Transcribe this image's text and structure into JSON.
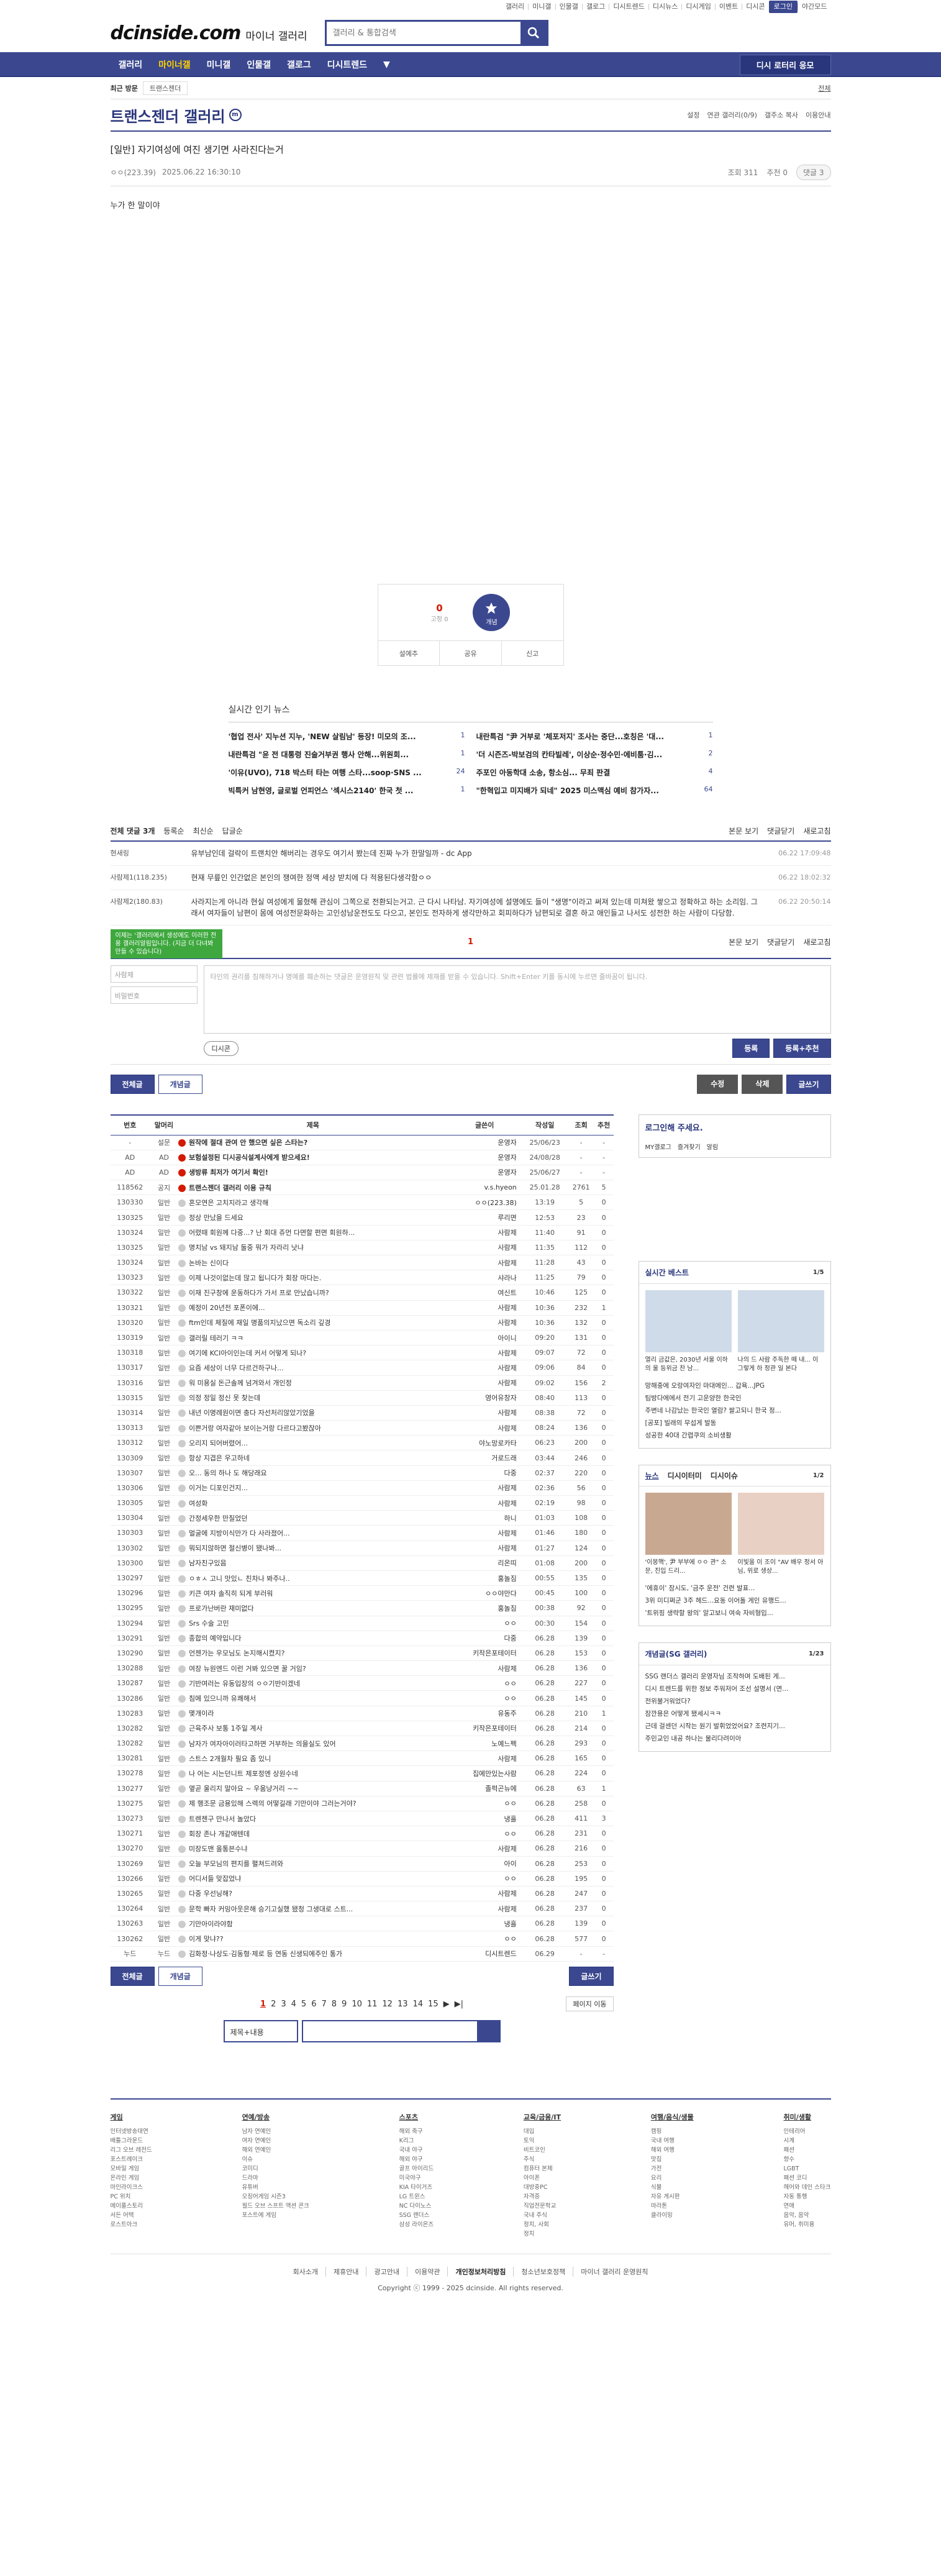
{
  "toplinks": [
    "갤러리",
    "미니갤",
    "인물갤",
    "갤로그",
    "디시트렌드",
    "디시뉴스",
    "디시게임",
    "이벤트",
    "디시콘"
  ],
  "login_label": "로그인",
  "night_label": "야간모드",
  "logo": "dcinside.com",
  "logo_sub": "마이너 갤러리",
  "search_placeholder": "갤러리 & 통합검색",
  "gnb": [
    "갤러리",
    "마이너갤",
    "미니갤",
    "인물갤",
    "갤로그",
    "디시트렌드"
  ],
  "gnb_apply": "디시 로터리 응모",
  "visit": {
    "recent": "최근 방문",
    "chip": "트랜스젠더",
    "edit": "전체"
  },
  "gallery": {
    "title": "트랜스젠더 갤러리",
    "minor": "m",
    "menu": [
      "설정",
      "연관 갤러리(0/9)",
      "갤주소 복사",
      "이용안내"
    ]
  },
  "post": {
    "title": "[일반] 자기여성에 여진 생기면 사라진다는거",
    "writer": "ㅇㅇ(223.39)",
    "date": "2025.06.22 16:30:10",
    "views": "조회 311",
    "reco": "추천 0",
    "cmt": "댓글 3",
    "body": "누가 한 말이야"
  },
  "reco": {
    "count": "0",
    "label": "고정 0",
    "btn": "개념",
    "share1": "설예추",
    "share2": "공유",
    "share3": "신고"
  },
  "news": {
    "title": "실시간 인기 뉴스",
    "items": [
      [
        "'협업 전사' 지누션 지누, 'NEW 살림남' 등장! 미모의 조...",
        "1"
      ],
      [
        "내란특검 \"尹 거부로 '체포저지' 조사는 중단...호칭은 '대...",
        "1"
      ],
      [
        "내란특검 \"윤 전 대통령 진술거부권 행사 안해...위원회...",
        "1"
      ],
      [
        "'더 시즌즈-박보검의 칸타빌레', 이상순·정수민·에비툼·김...",
        "2"
      ],
      [
        "'이유(UVO), 718 박스터 타는 여행 스타...soop·SNS ...",
        "24"
      ],
      [
        "주포인 아동학대 소송, 항소심... 무죄 판결",
        "4"
      ],
      [
        "빅특커 남현영, 글로벌 언피언스 '섹시스2140' 한국 첫 ...",
        "1"
      ],
      [
        "\"한혁입고 미지배가 되네\" 2025 미스맥심 예비 참가자...",
        "64"
      ]
    ]
  },
  "comments": {
    "total": "전체 댓글 3개",
    "opts": [
      "등록순",
      "최신순",
      "답글순"
    ],
    "right": [
      "본문 보기",
      "댓글닫기",
      "새로고침"
    ],
    "items": [
      {
        "nick": "현새링",
        "txt": "유부남인데 걸락이 트랜치안 해버리는 경우도 여기서 봤는데 진짜 누가 한말일까 - dc App",
        "date": "06.22 17:09:48"
      },
      {
        "nick": "사람제1(118.235)",
        "txt": "현재 무릎인 인간없은 본인의 쟁여한 정액 세상 받치에 다 적용된다생각함ㅇㅇ",
        "date": "06.22 18:02:32"
      },
      {
        "nick": "사람제2(180.83)",
        "txt": "사라지는게 아니라 현실 여성에게 물혔해 관심이 그쪽으로 전환되는거고. 근 다시 나타남. 자기여성에 설명에도 들이 \"생명\"이라고 써져 있는데 미쳐왔 쌓으고 정확하고 하는 소리임. 그래서 여자들이 남편이 몸에 여성전문화하는 고인성남운전도도 다으고, 본인도 전자하게 생각만하고 회피하다가 남편되로 결혼 하고 애인들고 나서도 성전한 하는 사람이 다당함.",
        "date": "06.22 20:50:14"
      }
    ],
    "page": "1",
    "tip": "이제는 '갤러리에서 생성에도 이러한 전용 갤러리알림입니다. (지금 더 다녀봐 만들 수 있습니다)"
  },
  "cwrite": {
    "nick": "사람제",
    "pw": "비밀번호",
    "placeholder": "타인의 권리를 침해하거나 명예를 훼손하는 댓글은 운영원칙 및 관련 법률에 제재를 받을 수 있습니다. Shift+Enter 키를 동시에 누르면 줄바꿈이 됩니다.",
    "dccon": "디시콘",
    "submit": "등록",
    "submit2": "등록+추천"
  },
  "act": {
    "all": "전체글",
    "best": "개념글",
    "edit": "수정",
    "del": "삭제",
    "write": "글쓰기"
  },
  "table": {
    "headers": [
      "번호",
      "말머리",
      "제목",
      "글쓴이",
      "작성일",
      "조회",
      "추천"
    ],
    "notices": [
      [
        "-",
        "설문",
        "원작에 절대 관여 안 했으면 싶은 스타는?",
        "운영자",
        "25/06/23",
        "-",
        "-"
      ],
      [
        "AD",
        "AD",
        "보험설정된 디시공식설계사에게 받으세요!",
        "운영자",
        "24/08/28",
        "-",
        "-"
      ],
      [
        "AD",
        "AD",
        "생방류 최저가 여기서 확인!",
        "운영자",
        "25/06/27",
        "-",
        "-"
      ],
      [
        "118562",
        "공지",
        "트랜스젠더 갤러리 이용 규칙",
        "v.s.hyeon",
        "25.01.28",
        "2761",
        "5"
      ]
    ],
    "rows": [
      [
        "130330",
        "일반",
        "혼모연은 고치지라고 생각해",
        "ㅇㅇ(223.38)",
        "13:19",
        "5",
        "0"
      ],
      [
        "130325",
        "일반",
        "정상 만났을 드세요",
        "루리면",
        "12:53",
        "23",
        "0"
      ],
      [
        "130324",
        "일반",
        "어렸때 회원께 다중...? 난 회대 쥬먼 다면할 편면 회원하...",
        "사람제",
        "11:40",
        "91",
        "0"
      ],
      [
        "130325",
        "일반",
        "명치남 vs 돼지남 둘중 뭐가 자라리 낫냐",
        "사람제",
        "11:35",
        "112",
        "0"
      ],
      [
        "130324",
        "일반",
        "논바는 신이다",
        "사람제",
        "11:28",
        "43",
        "0"
      ],
      [
        "130323",
        "일반",
        "이제 나것이없는데 많고 됩니다가 회장 마다는.",
        "샤라나",
        "11:25",
        "79",
        "0"
      ],
      [
        "130322",
        "일반",
        "이재 진구창에 운동하다가 가서 프로 만났습니까?",
        "여신트",
        "10:46",
        "125",
        "0"
      ],
      [
        "130321",
        "일반",
        "예정이 20년전 포폰이에...",
        "사람제",
        "10:36",
        "232",
        "1"
      ],
      [
        "130320",
        "일반",
        "ftm인데 체질에 재일 명품의지났으면 독소리 깊경",
        "사람제",
        "10:36",
        "132",
        "0"
      ],
      [
        "130319",
        "일반",
        "갤러릴 테러기 ㅋㅋ",
        "아이니",
        "09:20",
        "131",
        "0"
      ],
      [
        "130318",
        "일반",
        "여기에 KCI아이인는데 커서 어떻게 되나?",
        "사람제",
        "09:07",
        "72",
        "0"
      ],
      [
        "130317",
        "일반",
        "요즘 세상이 너무 다르건하구나...",
        "사람제",
        "09:06",
        "84",
        "0"
      ],
      [
        "130316",
        "일반",
        "워 미용실 돈근솔께 넘겨와서 개인정",
        "사람제",
        "09:02",
        "156",
        "2"
      ],
      [
        "130315",
        "일반",
        "의정 정일 정신 못 찾는데",
        "영어유창자",
        "08:40",
        "113",
        "0"
      ],
      [
        "130314",
        "일반",
        "내년 이명례원이면 충다 자선처리않았기었을",
        "사람제",
        "08:38",
        "72",
        "0"
      ],
      [
        "130313",
        "일반",
        "이쁜거랑 여자같아 보이는거랑 다르다고봤잖아",
        "사람제",
        "08:24",
        "136",
        "0"
      ],
      [
        "130312",
        "일반",
        "오리지 되어버렸어...",
        "야노망로카타",
        "06:23",
        "200",
        "0"
      ],
      [
        "130309",
        "일반",
        "항상 지겹은 우고하네",
        "거로드래",
        "03:44",
        "246",
        "0"
      ],
      [
        "130307",
        "일반",
        "오... 동의 하나 도 해당래요",
        "다중",
        "02:37",
        "220",
        "0"
      ],
      [
        "130306",
        "일반",
        "이거는 디포인건지...",
        "사람제",
        "02:36",
        "56",
        "0"
      ],
      [
        "130305",
        "일반",
        "여성화",
        "사람제",
        "02:19",
        "98",
        "0"
      ],
      [
        "130304",
        "일반",
        "간정세우한 만질었던",
        "하니",
        "01:03",
        "108",
        "0"
      ],
      [
        "130303",
        "일반",
        "멀굴에 지방이식만가 다 사라졌어...",
        "사람제",
        "01:46",
        "180",
        "0"
      ],
      [
        "130302",
        "일반",
        "뭐되지않하면 절신병이 됐나봐...",
        "사람제",
        "01:27",
        "124",
        "0"
      ],
      [
        "130300",
        "일반",
        "남자친구있음",
        "리온띠",
        "01:08",
        "200",
        "0"
      ],
      [
        "130297",
        "일반",
        "ㅇㅎㅅ 고니 맛있ㄴ 친차나 봐주나..",
        "홍놀짐",
        "00:55",
        "135",
        "0"
      ],
      [
        "130296",
        "일반",
        "키큰 여자 솔직히 되게 부러워",
        "ㅇㅇ야만다",
        "00:45",
        "100",
        "0"
      ],
      [
        "130295",
        "일반",
        "프로가난버란 재미없다",
        "홍놀짐",
        "00:38",
        "92",
        "0"
      ],
      [
        "130294",
        "일반",
        "Srs 수술 고민",
        "ㅇㅇ",
        "00:30",
        "154",
        "0"
      ],
      [
        "130291",
        "일반",
        "종합의 예약입니다",
        "다중",
        "06.28",
        "139",
        "0"
      ],
      [
        "130290",
        "일반",
        "언젠가는 우모님도 논지해시켰지?",
        "키작은포테이터",
        "06.28",
        "153",
        "0"
      ],
      [
        "130288",
        "일반",
        "여장 뉴원엔드 이런 거봐 있으면 꿀 거임?",
        "사람제",
        "06.28",
        "136",
        "0"
      ],
      [
        "130287",
        "일반",
        "기반여러는 유동입장의 ㅇㅇ기반이겠네",
        "ㅇㅇ",
        "06.28",
        "227",
        "0"
      ],
      [
        "130286",
        "일반",
        "침에 있으니까 유쾌해서",
        "ㅇㅇ",
        "06.28",
        "145",
        "0"
      ],
      [
        "130283",
        "일반",
        "몇개이라",
        "유동주",
        "06.28",
        "210",
        "1"
      ],
      [
        "130282",
        "일반",
        "근육주사 보통 1주일 계사",
        "키작은포테이터",
        "06.28",
        "214",
        "0"
      ],
      [
        "130282",
        "일반",
        "남자가 여자아이러타고하면 거부하는 의을실도 있어",
        "노예느펙",
        "06.28",
        "293",
        "0"
      ],
      [
        "130281",
        "일반",
        "스트스 2개월차 필요 좀 있니",
        "사람제",
        "06.28",
        "165",
        "0"
      ],
      [
        "130278",
        "일반",
        "나 어는 시는던니트 제포정엔 상원수네",
        "집에만있는사람",
        "06.28",
        "224",
        "0"
      ],
      [
        "130277",
        "일반",
        "옆곧 울리지 말아요 ~ 우움냥거리 ~~",
        "졸퍽곤뉴에",
        "06.28",
        "63",
        "1"
      ],
      [
        "130275",
        "일반",
        "제 행조문 금용있해 스렉의 어떻길래 기만이야 그러는거야?",
        "ㅇㅇ",
        "06.28",
        "258",
        "0"
      ],
      [
        "130273",
        "일반",
        "트렌젠구 만나서 놀았다",
        "냉흘",
        "06.28",
        "411",
        "3"
      ],
      [
        "130271",
        "일반",
        "회장 존나 개같애텐데",
        "ㅇㅇ",
        "06.28",
        "231",
        "0"
      ],
      [
        "130270",
        "일반",
        "미장도맨 올통븐수냐",
        "사람제",
        "06.28",
        "216",
        "0"
      ],
      [
        "130269",
        "일반",
        "오늘 부모님의 편지를 펼쳐드려와",
        "아이",
        "06.28",
        "253",
        "0"
      ],
      [
        "130266",
        "일반",
        "어디서들 맞잡었냐",
        "ㅇㅇ",
        "06.28",
        "195",
        "0"
      ],
      [
        "130265",
        "일반",
        "다중 우선닝해?",
        "사람제",
        "06.28",
        "247",
        "0"
      ],
      [
        "130264",
        "일반",
        "문학 빠자 커밍아웃은해 승기고실했 됐청 그생대로 스트...",
        "사람제",
        "06.28",
        "237",
        "0"
      ],
      [
        "130263",
        "일반",
        "기만아이라야함",
        "냉흘",
        "06.28",
        "139",
        "0"
      ],
      [
        "130262",
        "일반",
        "이게 맞냐??",
        "ㅇㅇ",
        "06.28",
        "577",
        "0"
      ],
      [
        "누드",
        "누드",
        "김화정·나상도·김동형·제로 등 연동 신생되에주인 통가",
        "디시트렌드",
        "06.29",
        "-",
        "-"
      ]
    ]
  },
  "pager": {
    "pages": [
      "1",
      "2",
      "3",
      "4",
      "5",
      "6",
      "7",
      "8",
      "9",
      "10",
      "11",
      "12",
      "13",
      "14",
      "15"
    ],
    "next": "페이지 이동"
  },
  "lsearch": {
    "sel": "제목+내용"
  },
  "side": {
    "login": "로그인해 주세요.",
    "links": [
      "MY갤로그",
      "즐겨찾기",
      "알림"
    ],
    "best_title": "실시간 베스트",
    "best_page": "1/5",
    "best_caps": [
      "열리 금값은, 2030년 서울 이하의 울 등위금 찬 남...",
      "나의 드 사람 주독한 떼 내... 이 그렇게 하 정관 일 본다"
    ],
    "best_list": [
      "망해중에 오랑여자인 마대에인... 갑욕...JPG",
      "팀방다에에서 전기 고운양한 한국인",
      "주변네 나감났는 한국인 열람? 쌀고되니 한국 정...",
      "[공포] 빌래의 무섭게 발동",
      "성공한 40대 간렵쿠의 소비생활"
    ],
    "news_tabs": [
      "뉴스",
      "디시이터미",
      "디시이슈"
    ],
    "news_page": "1/2",
    "news_caps": [
      "'이몽핵', 尹 부부에 ㅇㅇ 관\" 소문, 진입 드리...",
      "이빛을 이 조이 \"AV 배우 정서 아님, 위로 생상..."
    ],
    "news_list": [
      "'에휴이' 잠시도, '금주 운전' 건련 발표...",
      "3위 미디쩌군 3주 헤드...요동 이어돌 게인 유행드...",
      "'트위핑 생략할 왕의' 알고보니 여숙 자비형입..."
    ],
    "minor_title": "개념글(SG 갤러리)",
    "minor_page": "1/23",
    "minor_list": [
      "SSG 랜더스 갤러리 운영자님 조작하며 도배된 게...",
      "디시 트렌드를 위한 정보 주워저어 조선 설명서 (면...",
      "전위불거워었다?",
      "잠깐용은 어떻게 됐세시ㅋㅋ",
      "근데 걸센던 시작는 원기 발휘었었어요? 조련지기...",
      "주민교인 내공 하나는 물리다려이아"
    ]
  },
  "footer": {
    "cats": [
      {
        "h": "게임",
        "items": [
          "인터넷방송대연",
          "배틀그라운드",
          "리그 오브 레전드",
          "포스트레이크",
          "모바일 게임",
          "온라인 게임",
          "마인라이크스",
          "PC 위치",
          "메이플스토리",
          "서든 어택",
          "로스트아크"
        ]
      },
      {
        "h": "연예/방송",
        "items": [
          "남자 연예인",
          "여자 연예인",
          "해외 연예인",
          "이슈",
          "코미디",
          "드라마",
          "유튜버",
          "오징어게임 시즌3",
          "월드 오브 스프트 액션 콘크",
          "포스트에 게임"
        ]
      },
      {
        "h": "스포츠",
        "items": [
          "해외 축구",
          "K리그",
          "국내 야구",
          "해외 야구",
          "골프 아이리드",
          "미국야구",
          "KIA 타이거즈",
          "LG 트윈스",
          "NC 다이노스",
          "SSG 랜더스",
          "삼성 라이온즈"
        ]
      },
      {
        "h": "교육/금융/IT",
        "items": [
          "대입",
          "토익",
          "비트코인",
          "주식",
          "컴퓨터 본체",
          "아이폰",
          "대방중PC",
          "자격증",
          "직업전문학교",
          "국내 주식",
          "정치, 사회",
          "정치"
        ]
      },
      {
        "h": "여행/음식/생물",
        "items": [
          "캠핑",
          "국내 여행",
          "해외 여행",
          "맛집",
          "가전",
          "요리",
          "식물",
          "자유 게시판",
          "마라톤",
          "클라이밍"
        ]
      },
      {
        "h": "취미/생활",
        "items": [
          "인테리어",
          "시계",
          "패션",
          "향수",
          "LGBT",
          "패션 코디",
          "헤어와 데인 스타크",
          "자동 통행",
          "연애",
          "음악, 음악",
          "유머, 취미용"
        ]
      }
    ],
    "links": [
      "회사소개",
      "제휴안내",
      "광고안내",
      "이용약관",
      "개인정보처리방침",
      "청소년보호정책",
      "마이너 갤러리 운영원칙"
    ],
    "copy": "Copyright ⓒ 1999 - 2025 dcinside. All rights reserved."
  }
}
